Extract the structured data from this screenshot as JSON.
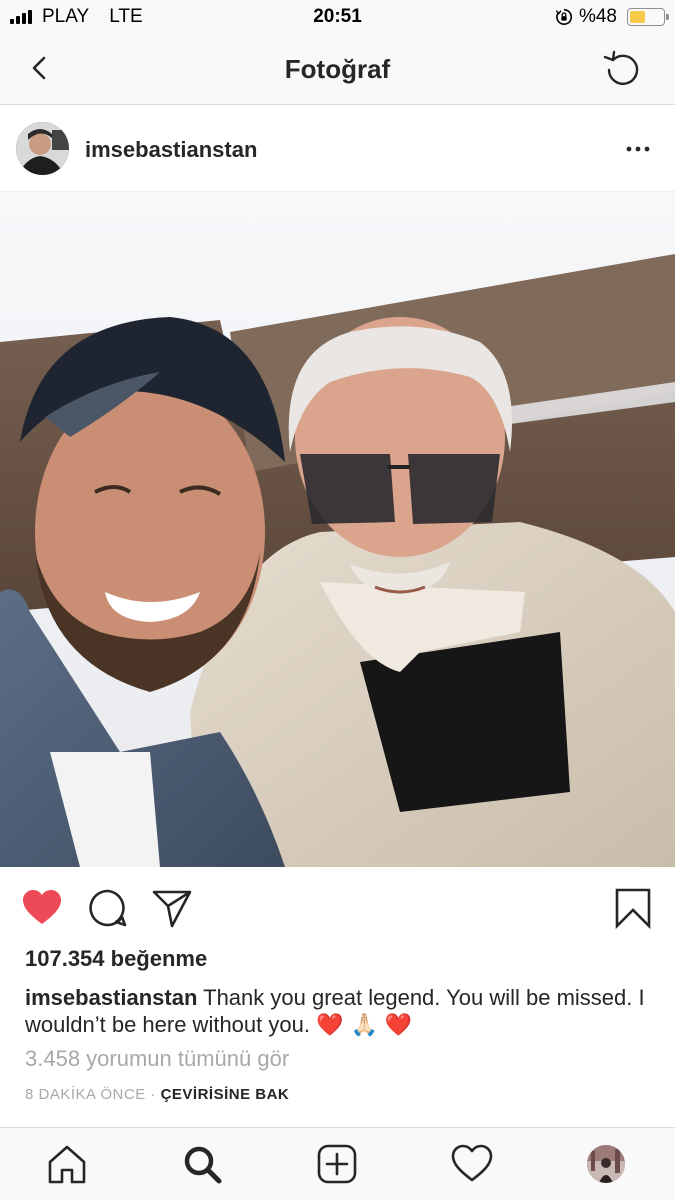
{
  "status_bar": {
    "carrier": "PLAY",
    "network": "LTE",
    "time": "20:51",
    "battery_percent": "%48",
    "battery_level": 0.48,
    "battery_color": "#f7c948"
  },
  "nav": {
    "title": "Fotoğraf",
    "back_icon": "chevron-left-icon",
    "refresh_icon": "refresh-icon"
  },
  "post": {
    "username": "imsebastianstan",
    "more_icon": "more-horizontal-icon",
    "likes": "107.354 beğenme",
    "liked": true,
    "like_color": "#ed4956",
    "caption": {
      "user": "imsebastianstan",
      "text": "Thank you great legend. You will be missed. I wouldn’t be here without you.",
      "emojis": "❤️ 🙏🏻 ❤️"
    },
    "comments_link": "3.458 yorumun tümünü gör",
    "time_ago": "8 DAKİKA ÖNCE",
    "separator": " · ",
    "translate": "ÇEVİRİSİNE BAK"
  },
  "tab_bar": {
    "items": [
      "home-icon",
      "search-icon",
      "add-icon",
      "activity-icon",
      "profile-avatar"
    ]
  }
}
